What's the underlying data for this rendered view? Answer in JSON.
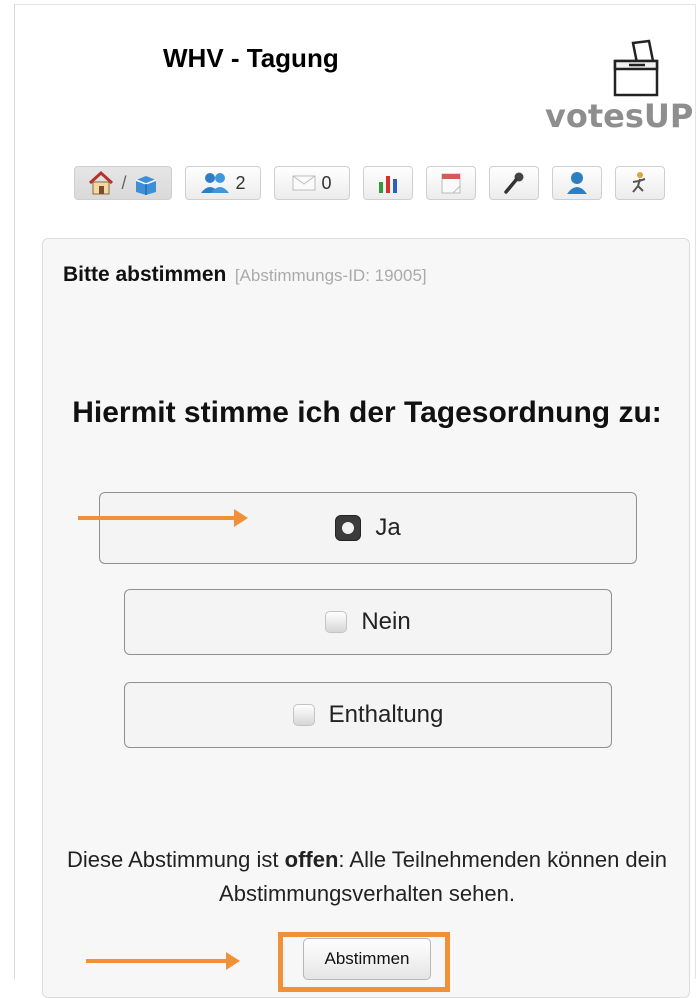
{
  "header": {
    "event_title": "WHV - Tagung",
    "logo_text": "votesUP!"
  },
  "toolbar": {
    "items": [
      {
        "icon": "home-ballot-icon",
        "separator": "/"
      },
      {
        "icon": "participants-icon",
        "count": "2"
      },
      {
        "icon": "mail-icon",
        "count": "0"
      },
      {
        "icon": "chart-icon"
      },
      {
        "icon": "calendar-icon"
      },
      {
        "icon": "microphone-icon"
      },
      {
        "icon": "user-icon"
      },
      {
        "icon": "exit-icon"
      }
    ]
  },
  "vote": {
    "title": "Bitte abstimmen",
    "meta": "[Abstimmungs-ID: 19005]",
    "question": "Hiermit stimme ich der Tagesordnung zu:",
    "options": [
      {
        "label": "Ja",
        "checked": true
      },
      {
        "label": "Nein",
        "checked": false
      },
      {
        "label": "Enthaltung",
        "checked": false
      }
    ],
    "note_prefix": "Diese Abstimmung ist ",
    "note_bold": "offen",
    "note_suffix": ": Alle Teilnehmenden können dein Abstimmungsverhalten sehen.",
    "submit_label": "Abstimmen"
  },
  "colors": {
    "annotation_arrow": "#f0913a",
    "panel_background": "#f7f7f7",
    "logo_gray": "#8e8e8e"
  }
}
